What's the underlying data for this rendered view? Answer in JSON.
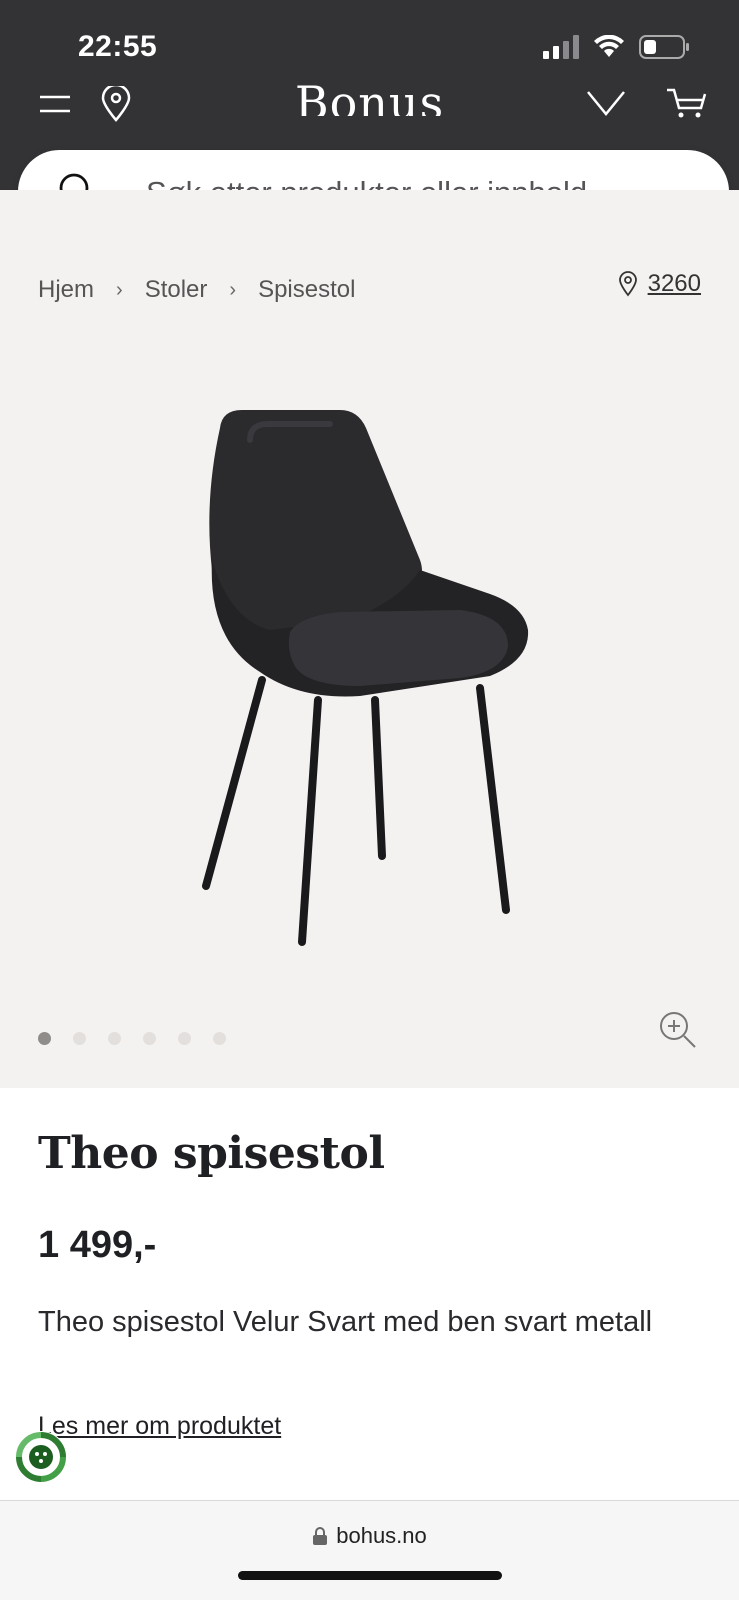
{
  "status_bar": {
    "time": "22:55"
  },
  "header": {
    "logo": "Bonus",
    "colors": {
      "header_bg": "#333336",
      "gallery_bg": "#f4f2f1"
    }
  },
  "search": {
    "placeholder": "Søk etter produkter eller innhold..."
  },
  "breadcrumb": {
    "items": [
      "Hjem",
      "Stoler",
      "Spisestol"
    ]
  },
  "store": {
    "number": "3260"
  },
  "gallery": {
    "image_count": 6,
    "active_index": 0
  },
  "product": {
    "title": "Theo spisestol",
    "price": "1 499,-",
    "description": "Theo spisestol Velur Svart med ben svart metall",
    "more_link": "Les mer om produktet"
  },
  "browser": {
    "url": "bohus.no"
  }
}
